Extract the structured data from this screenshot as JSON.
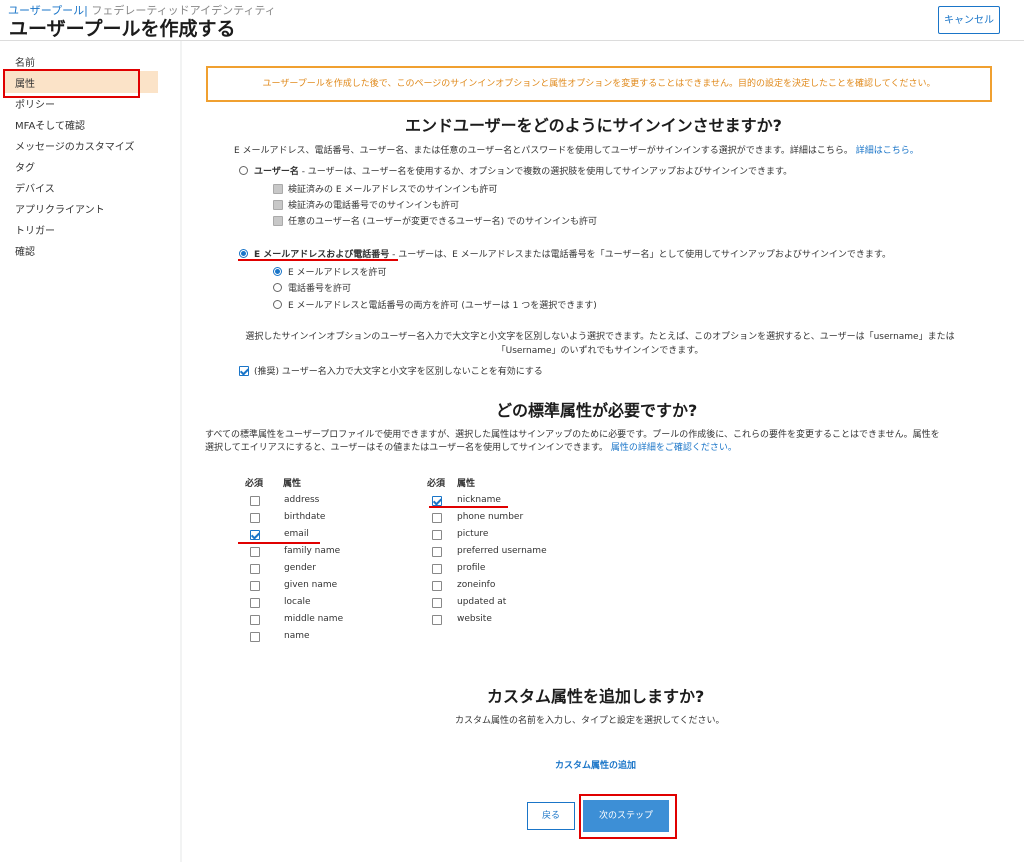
{
  "header": {
    "breadcrumb_link": "ユーザープール",
    "breadcrumb_sep": "|",
    "breadcrumb_current": " フェデレーティッドアイデンティティ",
    "title": "ユーザープールを作成する",
    "cancel_label": "キャンセル"
  },
  "sidebar": {
    "items": [
      "名前",
      "属性",
      "ポリシー",
      "MFAそして確認",
      "メッセージのカスタマイズ",
      "タグ",
      "デバイス",
      "アプリクライアント",
      "トリガー",
      "確認"
    ],
    "active_index": 1
  },
  "warning": "ユーザープールを作成した後で、このページのサインインオプションと属性オプションを変更することはできません。目的の設定を決定したことを確認してください。",
  "signin": {
    "heading": "エンドユーザーをどのようにサインインさせますか?",
    "intro": "E メールアドレス、電話番号、ユーザー名、または任意のユーザー名とパスワードを使用してユーザーがサインインする選択ができます。詳細はこちら。",
    "intro_link": "詳細はこちら。",
    "username_option": {
      "label": "ユーザー名",
      "desc": " - ユーザーは、ユーザー名を使用するか、オプションで複数の選択肢を使用してサインアップおよびサインインできます。",
      "selected": false,
      "suboptions": [
        "検証済みの E メールアドレスでのサインインも許可",
        "検証済みの電話番号でのサインインも許可",
        "任意のユーザー名 (ユーザーが変更できるユーザー名) でのサインインも許可"
      ]
    },
    "email_phone_option": {
      "label": "E メールアドレスおよび電話番号",
      "desc": " - ユーザーは、E メールアドレスまたは電話番号を「ユーザー名」として使用してサインアップおよびサインインできます。",
      "selected": true,
      "suboptions": [
        {
          "label": "E メールアドレスを許可",
          "selected": true
        },
        {
          "label": "電話番号を許可",
          "selected": false
        },
        {
          "label": "E メールアドレスと電話番号の両方を許可 (ユーザーは 1 つを選択できます)",
          "selected": false
        }
      ]
    },
    "case_note_1": "選択したサインインオプションのユーザー名入力で大文字と小文字を区別しないよう選択できます。たとえば、このオプションを選択すると、ユーザーは「username」または",
    "case_note_2": "「Username」のいずれでもサインインできます。",
    "case_checkbox_label": "(推奨) ユーザー名入力で大文字と小文字を区別しないことを有効にする",
    "case_checked": true
  },
  "attributes": {
    "heading": "どの標準属性が必要ですか?",
    "intro_1": "すべての標準属性をユーザープロファイルで使用できますが、選択した属性はサインアップのために必要です。プールの作成後に、これらの要件を変更することはできません。属性を",
    "intro_2": "選択してエイリアスにすると、ユーザーはその値またはユーザー名を使用してサインインできます。",
    "intro_link": "属性の詳細をご確認ください。",
    "col_required": "必須",
    "col_attribute": "属性",
    "left": [
      {
        "name": "address",
        "required": false
      },
      {
        "name": "birthdate",
        "required": false
      },
      {
        "name": "email",
        "required": true
      },
      {
        "name": "family name",
        "required": false
      },
      {
        "name": "gender",
        "required": false
      },
      {
        "name": "given name",
        "required": false
      },
      {
        "name": "locale",
        "required": false
      },
      {
        "name": "middle name",
        "required": false
      },
      {
        "name": "name",
        "required": false
      }
    ],
    "right": [
      {
        "name": "nickname",
        "required": true
      },
      {
        "name": "phone number",
        "required": false
      },
      {
        "name": "picture",
        "required": false
      },
      {
        "name": "preferred username",
        "required": false
      },
      {
        "name": "profile",
        "required": false
      },
      {
        "name": "zoneinfo",
        "required": false
      },
      {
        "name": "updated at",
        "required": false
      },
      {
        "name": "website",
        "required": false
      }
    ]
  },
  "custom": {
    "heading": "カスタム属性を追加しますか?",
    "desc": "カスタム属性の名前を入力し、タイプと設定を選択してください。",
    "add_link": "カスタム属性の追加"
  },
  "footer": {
    "back_label": "戻る",
    "next_label": "次のステップ"
  },
  "colors": {
    "accent": "#1a75c8",
    "warning_border": "#f0a030",
    "warning_text": "#e08a1c",
    "annotation_red": "#e00000",
    "active_nav_bg": "#fbe3c8",
    "primary_button": "#3d8fd6"
  }
}
